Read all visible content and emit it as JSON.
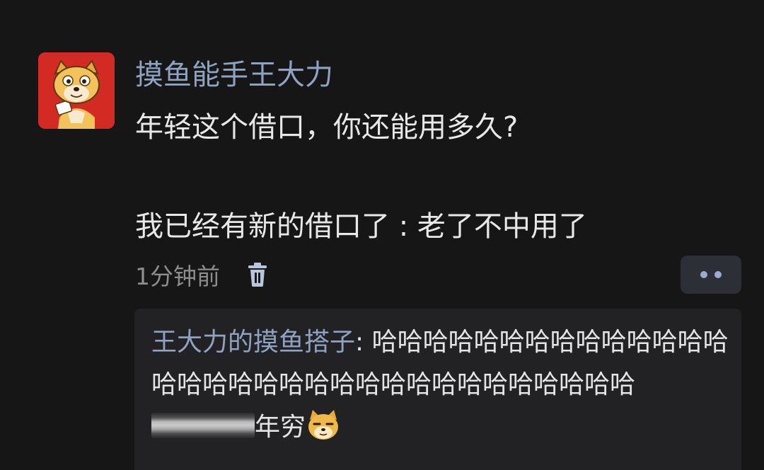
{
  "post": {
    "username": "摸鱼能手王大力",
    "lines": [
      "年轻这个借口，你还能用多久?",
      "",
      "我已经有新的借口了 : 老了不中用了"
    ],
    "time": "1分钟前"
  },
  "reply": {
    "author": "王大力的摸鱼搭子",
    "separator": ": ",
    "text": "哈哈哈哈哈哈哈哈哈哈哈哈哈哈哈哈哈哈哈哈哈哈哈哈哈哈哈哈哈哈哈哈哈",
    "suffix": "年穷"
  },
  "colors": {
    "background": "#161616",
    "accent_name": "#8ea3c2",
    "avatar_bg": "#d42a24"
  },
  "icons": [
    "shiba-dog-avatar",
    "trash-icon",
    "more-dots-icon",
    "doge-emoji"
  ]
}
